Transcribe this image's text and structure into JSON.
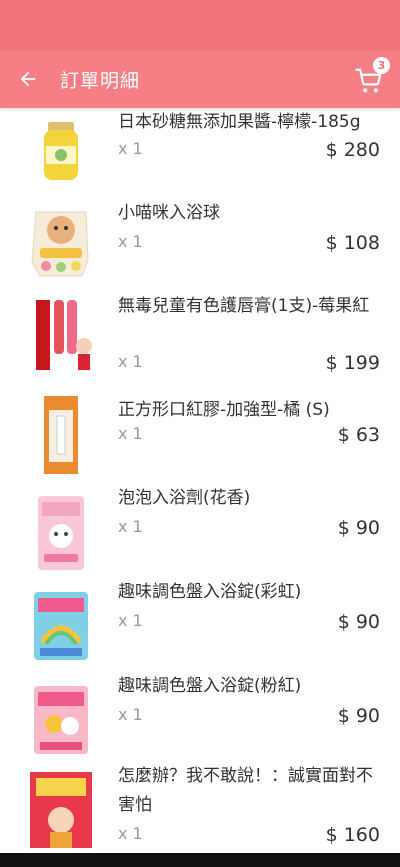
{
  "header": {
    "title": "訂單明細",
    "back_icon": "arrow-left-icon",
    "cart_icon": "shopping-cart-icon",
    "cart_count": "3"
  },
  "colors": {
    "header": "#f67f86",
    "status_bar": "#f0727a",
    "text": "#333333",
    "muted": "#999999"
  },
  "items": [
    {
      "name": "日本砂糖無添加果醬-檸檬-185g",
      "qty": "x 1",
      "price": "$ 280"
    },
    {
      "name": "小喵咪入浴球",
      "qty": "x 1",
      "price": "$ 108"
    },
    {
      "name": "無毒兒童有色護唇膏(1支)-莓果紅",
      "qty": "x 1",
      "price": "$ 199"
    },
    {
      "name": "正方形口紅膠-加強型-橘 (S)",
      "qty": "x 1",
      "price": "$ 63"
    },
    {
      "name": "泡泡入浴劑(花香)",
      "qty": "x 1",
      "price": "$ 90"
    },
    {
      "name": "趣味調色盤入浴錠(彩虹)",
      "qty": "x 1",
      "price": "$ 90"
    },
    {
      "name": "趣味調色盤入浴錠(粉紅)",
      "qty": "x 1",
      "price": "$ 90"
    },
    {
      "name": "怎麼辦？我不敢說！：誠實面對不害怕",
      "qty": "x 1",
      "price": "$ 160"
    }
  ]
}
